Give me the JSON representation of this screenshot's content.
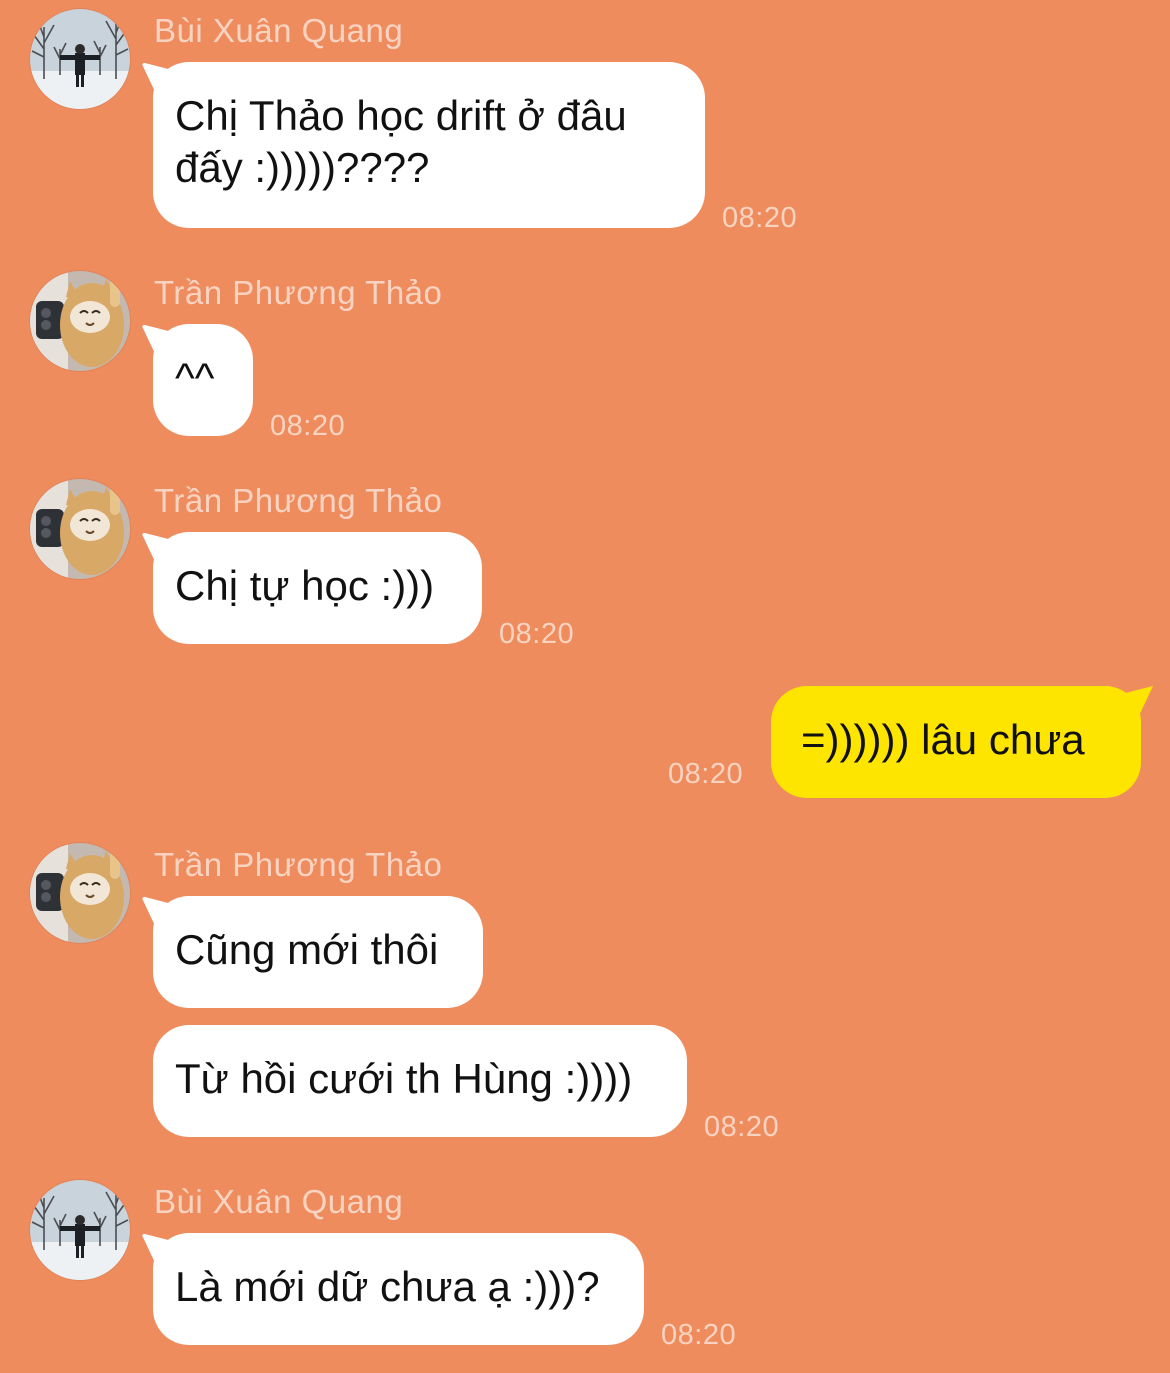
{
  "colors": {
    "background": "#EF8C5E",
    "incoming_bubble": "#FFFFFF",
    "outgoing_bubble": "#FEE500",
    "meta_text": "rgba(255,255,255,0.62)"
  },
  "messages": [
    {
      "sender": "Bùi Xuân Quang",
      "avatar": "man-in-snow-avatar",
      "text": "Chị Thảo học drift ở đâu\nđấy :)))))????",
      "time": "08:20"
    },
    {
      "sender": "Trần Phương Thảo",
      "avatar": "cat-selfie-avatar",
      "text": "^^",
      "time": "08:20"
    },
    {
      "sender": "Trần Phương Thảo",
      "avatar": "cat-selfie-avatar",
      "text": "Chị tự học :)))",
      "time": "08:20"
    },
    {
      "sender": "",
      "avatar": "",
      "text": "=)))))) lâu chưa",
      "time": "08:20",
      "outgoing": true
    },
    {
      "sender": "Trần Phương Thảo",
      "avatar": "cat-selfie-avatar",
      "text": "Cũng mới thôi",
      "time": ""
    },
    {
      "sender": "",
      "avatar": "",
      "text": "Từ hồi cưới th Hùng :))))",
      "time": "08:20"
    },
    {
      "sender": "Bùi Xuân Quang",
      "avatar": "man-in-snow-avatar",
      "text": "Là mới dữ chưa ạ :)))?",
      "time": "08:20"
    }
  ]
}
